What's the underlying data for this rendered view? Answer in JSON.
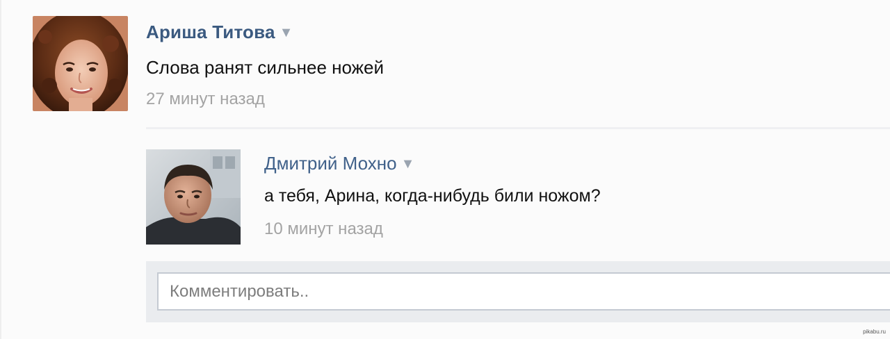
{
  "post": {
    "author": "Ариша Титова",
    "text": "Слова ранят сильнее ножей",
    "time": "27 минут назад",
    "menu_icon": "caret-down-icon"
  },
  "reply": {
    "author": "Дмитрий Мохно",
    "text": "а тебя, Арина, когда-нибудь били ножом?",
    "time": "10 минут назад",
    "menu_icon": "caret-down-icon"
  },
  "comment": {
    "placeholder": "Комментировать.."
  },
  "watermark": "pikabu.ru",
  "colors": {
    "author_link": "#3b5a80",
    "timestamp": "#a3a3a3",
    "comment_bg": "#eaecef"
  }
}
